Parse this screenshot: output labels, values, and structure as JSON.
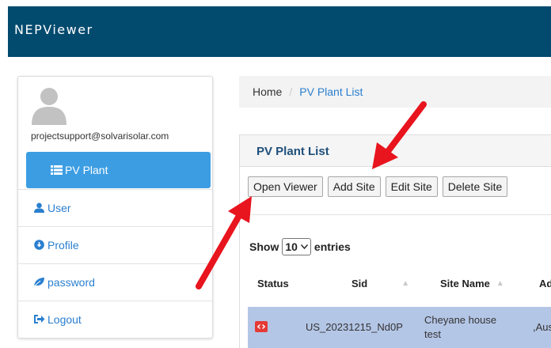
{
  "header": {
    "brand": "NEPViewer"
  },
  "sidebar": {
    "email": "projectsupport@solvarisolar.com",
    "items": [
      {
        "label": "PV Plant",
        "icon": "list-icon",
        "active": true
      },
      {
        "label": "User",
        "icon": "user-icon"
      },
      {
        "label": "Profile",
        "icon": "info-circle-icon"
      },
      {
        "label": "password",
        "icon": "leaf-icon"
      },
      {
        "label": "Logout",
        "icon": "logout-icon"
      }
    ]
  },
  "breadcrumb": {
    "home": "Home",
    "separator": "/",
    "current": "PV Plant List"
  },
  "panel": {
    "title": "PV Plant List",
    "buttons": [
      "Open Viewer",
      "Add Site",
      "Edit Site",
      "Delete Site"
    ],
    "show_label": "Show",
    "entries_value": "10",
    "entries_label": "entries",
    "columns": [
      "Status",
      "Sid",
      "Site Name",
      "Add"
    ],
    "rows": [
      {
        "status": "offline",
        "sid": "US_20231215_Nd0P",
        "site_name_line1": "Cheyane house",
        "site_name_line2": "test",
        "address": ",Aust"
      }
    ]
  },
  "colors": {
    "topbar": "#024a6e",
    "active": "#3c9de3",
    "link": "#2a7fcf",
    "row_selected": "#b4c6e6",
    "arrow": "#e8141e"
  }
}
